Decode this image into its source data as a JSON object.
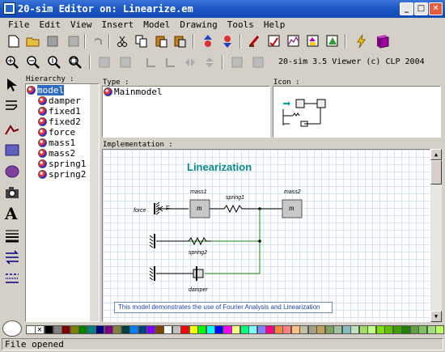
{
  "window": {
    "title": "20-sim Editor on: Linearize.em"
  },
  "menu": [
    "File",
    "Edit",
    "View",
    "Insert",
    "Model",
    "Drawing",
    "Tools",
    "Help"
  ],
  "toolbar2_text": "20-sim 3.5 Viewer (c) CLP 2004",
  "panels": {
    "hierarchy": "Hierarchy :",
    "type": "Type :",
    "icon": "Icon :",
    "implementation": "Implementation :"
  },
  "hierarchy_items": [
    "model",
    "damper",
    "fixed1",
    "fixed2",
    "force",
    "mass1",
    "mass2",
    "spring1",
    "spring2"
  ],
  "type_value": "Mainmodel",
  "diagram": {
    "title": "Linearization",
    "labels": {
      "mass1": "mass1",
      "spring1": "spring1",
      "mass2": "mass2",
      "force": "force",
      "F": "F",
      "m1": "m",
      "m2": "m",
      "spring2": "spring2",
      "damper": "damper"
    },
    "description": "This model demonstrates the use of Fourier Analysis and Linearization"
  },
  "palette": [
    "#000000",
    "#808080",
    "#800000",
    "#808000",
    "#008000",
    "#008080",
    "#000080",
    "#800080",
    "#808040",
    "#004040",
    "#0080ff",
    "#004080",
    "#8000ff",
    "#804000",
    "#ffffff",
    "#c0c0c0",
    "#ff0000",
    "#ffff00",
    "#00ff00",
    "#00ffff",
    "#0000ff",
    "#ff00ff",
    "#ffff80",
    "#00ff80",
    "#80ffff",
    "#8080ff",
    "#ff0080",
    "#ff8040",
    "#ff8080",
    "#ffc080",
    "#c0c0a0",
    "#a0a080",
    "#c0a060",
    "#80a060",
    "#a0c0a0",
    "#80c0c0",
    "#c0e0c0",
    "#a0e060",
    "#c0ff80",
    "#80e000",
    "#60c000",
    "#40a000",
    "#208000",
    "#60a040",
    "#80c060",
    "#a0e080",
    "#c0ff60"
  ],
  "status": "File opened",
  "colors": {
    "titlebar": "#1c56c4",
    "diagram_title": "#0a8a8a",
    "wire_green": "#1a8a1a",
    "description_text": "#2244aa"
  }
}
